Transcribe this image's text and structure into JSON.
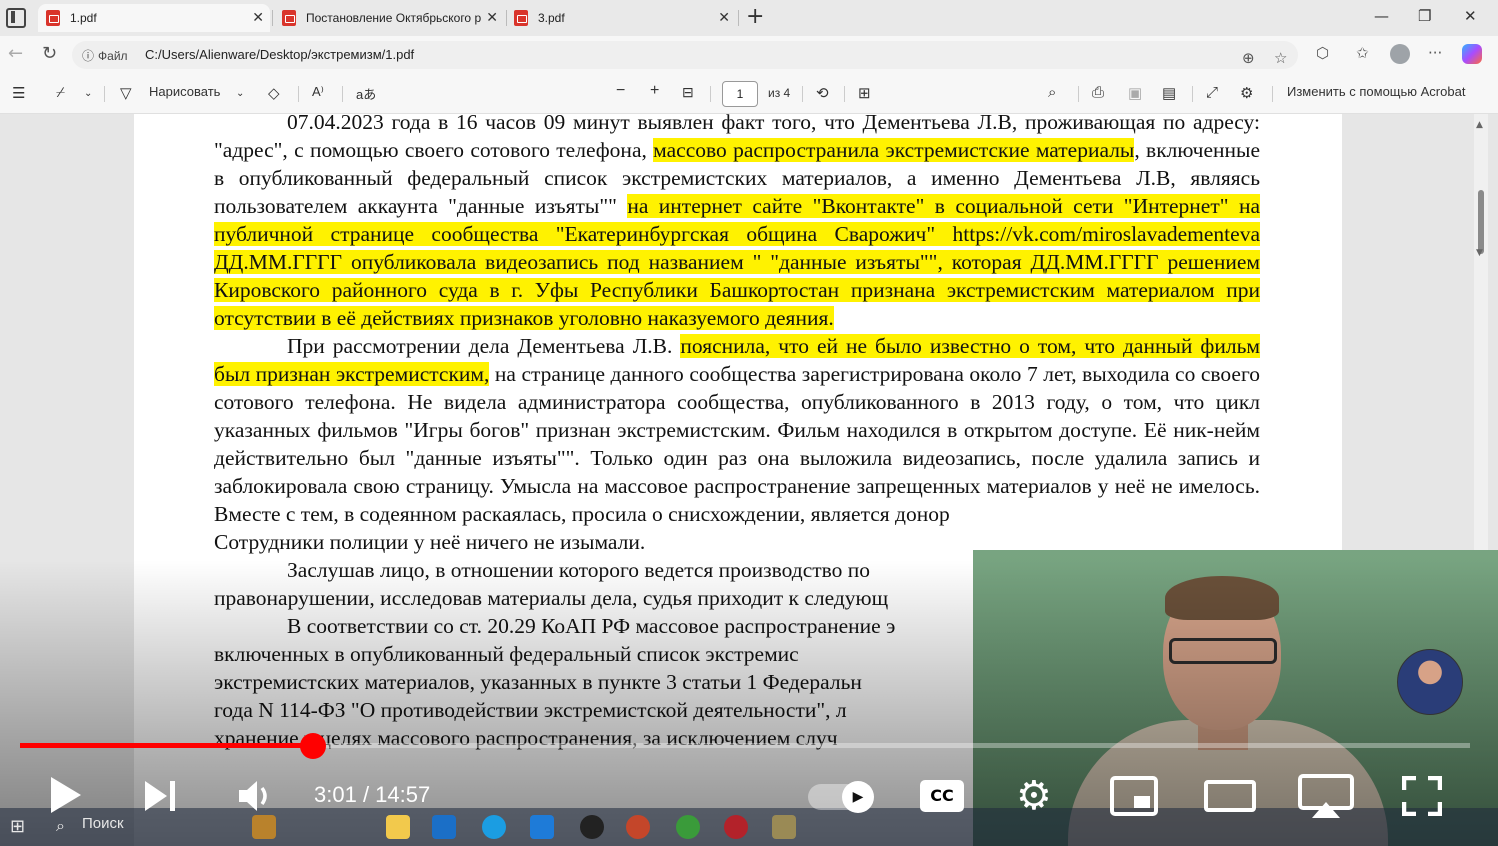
{
  "tabs": [
    {
      "label": "1.pdf"
    },
    {
      "label": "Постановление Октябрьского р"
    },
    {
      "label": "3.pdf"
    }
  ],
  "address": {
    "file_chip": "Файл",
    "url": "C:/Users/Alienware/Desktop/экстремизм/1.pdf"
  },
  "pdf_toolbar": {
    "draw_label": "Нарисовать",
    "page_current": "1",
    "page_total": "из 4",
    "edit_acrobat": "Изменить с помощью Acrobat"
  },
  "document": {
    "p1": {
      "t1": "07.04.2023 года в 16 часов 09 минут выявлен факт того, что Дементьева Л.В, проживающая по адресу: \"адрес\", с помощью своего сотового телефона, ",
      "h1": "массово распространила экстремистские материалы",
      "t2": ", включенные в опубликованный федеральный список экстремистских материалов, а именно Дементьева Л.В, являясь пользователем аккаунта \"данные изъяты\"\" ",
      "h2": "на интернет сайте \"Вконтакте\" в социальной сети \"Интернет\" на публичной странице сообщества \"Екатеринбургская община Сварожич\" https://vk.com/miroslavadementeva ДД.ММ.ГГГГ опубликовала видеозапись под названием \" \"данные изъяты\"\", которая ДД.ММ.ГГГГ решением Кировского районного суда в г. Уфы Республики Башкортостан признана экстремистским материалом при отсутствии в её действиях признаков уголовно наказуемого деяния."
    },
    "p2": {
      "t1": "При рассмотрении дела Дементьева Л.В. ",
      "h1": "пояснила, что ей не было известно о том, что данный фильм был признан экстремистским,",
      "t2": " на странице данного сообщества зарегистрирована около 7 лет, выходила со своего сотового телефона. Не видела администратора сообщества, опубликованного в 2013 году, о том, что цикл указанных фильмов \"Игры богов\" признан экстремистским. Фильм находился в открытом доступе. Её ник-нейм действительно был \"данные изъяты\"\". Только один раз она выложила видеозапись, после удалила запись и заблокировала свою страницу. Умысла на массовое распространение запрещенных материалов у неё не имелось. Вместе с тем, в содеянном раскаялась, просила о снисхождении, является донор",
      "t3": "Сотрудники полиции у неё ничего не изымали."
    },
    "p3": "Заслушав лицо, в отношении которого ведется производство по",
    "p3b": "правонарушении, исследовав материалы дела, судья приходит к следующ",
    "p4": "В соответствии со ст. 20.29 КоАП РФ массовое распространение э",
    "p4b": "включенных в опубликованный федеральный список экстремис",
    "p4c": "экстремистских материалов, указанных в пункте 3 статьи 1 Федеральн",
    "p4d": "года N 114-ФЗ \"О противодействии экстремистской деятельности\", л",
    "p4e": "хранение в целях массового распространения, за исключением случ"
  },
  "player": {
    "time_current": "3:01",
    "time_sep": " / ",
    "time_total": "14:57",
    "progress": 0.202,
    "cc_label": "CC"
  },
  "taskbar": {
    "search_label": "Поиск"
  },
  "colors": {
    "highlight": "#fff200",
    "progress": "#ff0000",
    "pdf_icon": "#d9342b"
  }
}
